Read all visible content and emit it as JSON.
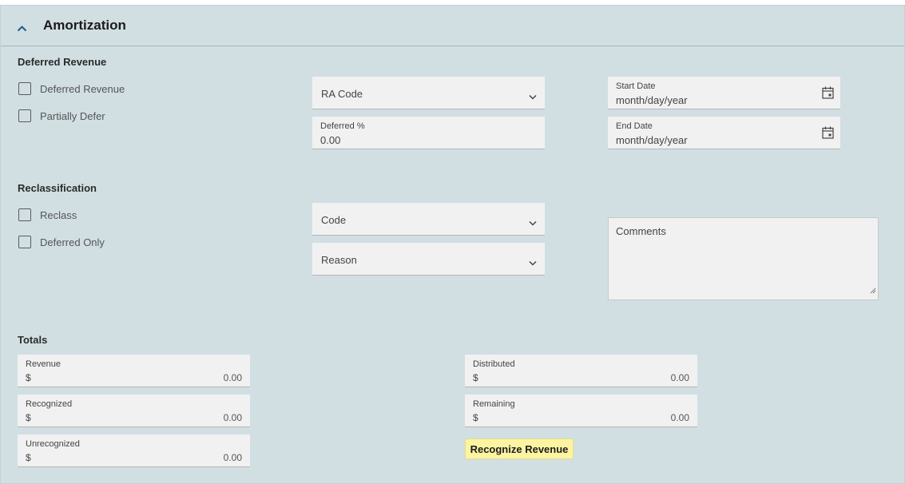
{
  "header": {
    "title": "Amortization"
  },
  "deferred": {
    "section_title": "Deferred Revenue",
    "checkboxes": [
      {
        "label": "Deferred Revenue",
        "checked": false
      },
      {
        "label": "Partially Defer",
        "checked": false
      }
    ],
    "ra_code": {
      "label": "RA Code"
    },
    "deferred_pct": {
      "label": "Deferred %",
      "value": "0.00"
    },
    "start_date": {
      "label": "Start Date",
      "placeholder": "month/day/year"
    },
    "end_date": {
      "label": "End Date",
      "placeholder": "month/day/year"
    }
  },
  "reclass": {
    "section_title": "Reclassification",
    "checkboxes": [
      {
        "label": "Reclass",
        "checked": false
      },
      {
        "label": "Deferred Only",
        "checked": false
      }
    ],
    "code": {
      "label": "Code"
    },
    "reason": {
      "label": "Reason"
    },
    "comments": {
      "label": "Comments"
    }
  },
  "totals": {
    "section_title": "Totals",
    "currency": "$",
    "revenue": {
      "label": "Revenue",
      "value": "0.00"
    },
    "recognized": {
      "label": "Recognized",
      "value": "0.00"
    },
    "unrecognized": {
      "label": "Unrecognized",
      "value": "0.00"
    },
    "distributed": {
      "label": "Distributed",
      "value": "0.00"
    },
    "remaining": {
      "label": "Remaining",
      "value": "0.00"
    },
    "recognize_button": "Recognize Revenue"
  },
  "colors": {
    "panel_bg": "#d1dfe3",
    "field_bg": "#f1f1f1",
    "button_bg": "#fdf4a2",
    "chevron_blue": "#1f5f86"
  },
  "icons": {
    "collapse": "chevron-up-icon",
    "dropdown": "chevron-down-icon",
    "date": "calendar-icon",
    "resize": "resize-grip-icon"
  }
}
